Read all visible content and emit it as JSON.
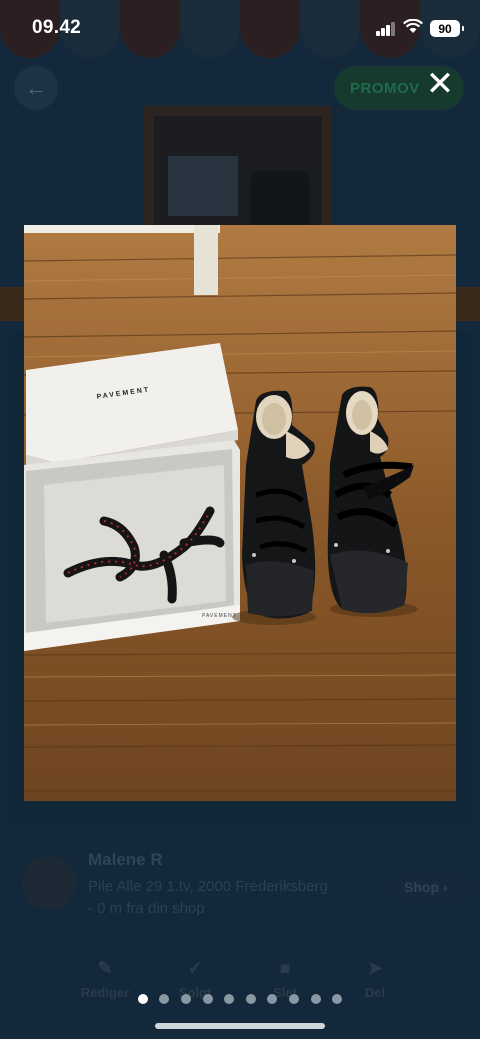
{
  "status_bar": {
    "time": "09.42",
    "battery": "90"
  },
  "background": {
    "promo_label": "PROMOV",
    "seller": {
      "name": "Malene R",
      "address": "Pile Alle 29 1.tv, 2000 Frederiksberg",
      "distance": "- 0 m fra din shop",
      "shop_label": "Shop"
    },
    "actions": [
      {
        "label": "Rediger",
        "icon": "pencil-icon"
      },
      {
        "label": "Solgt",
        "icon": "check-icon"
      },
      {
        "label": "Slet",
        "icon": "trash-icon"
      },
      {
        "label": "Del",
        "icon": "send-icon"
      }
    ]
  },
  "viewer": {
    "close_icon": "close-icon",
    "photo": {
      "box_brand": "PAVEMENT",
      "box_side_brand": "PAVEMENT",
      "subject": "black lace-up boots with shearling lining next to white shoe box with laces"
    },
    "pagination": {
      "total": 10,
      "current": 1
    }
  },
  "colors": {
    "accent_green": "#1f6a4a",
    "dim_overlay": "#0c1a24"
  }
}
